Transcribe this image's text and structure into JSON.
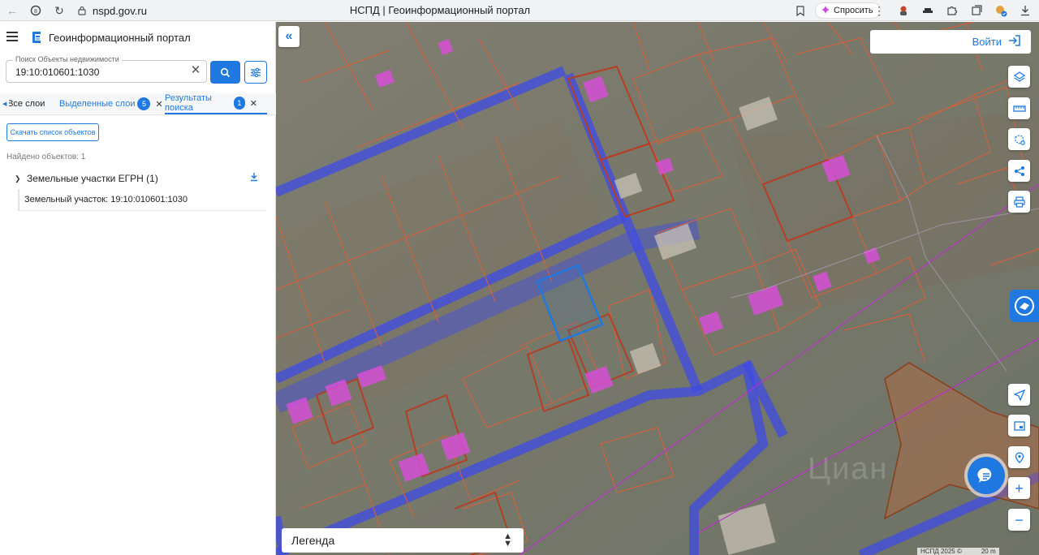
{
  "browser": {
    "url": "nspd.gov.ru",
    "tab_title": "НСПД | Геоинформационный портал",
    "ask_label": "Спросить"
  },
  "app": {
    "title": "Геоинформационный портал"
  },
  "search": {
    "legend": "Поиск Объекты недвижимости",
    "value": "19:10:010601:1030"
  },
  "tabs": [
    {
      "label": "Все слои"
    },
    {
      "label": "Выделенные слои",
      "badge": "5"
    },
    {
      "label": "Результаты поиска",
      "badge": "1"
    }
  ],
  "results": {
    "download_list": "Скачать список объектов",
    "found": "Найдено объектов: 1",
    "group_label": "Земельные участки ЕГРН (1)",
    "item_label": "Земельный участок: 19:10:010601:1030"
  },
  "map": {
    "login_label": "Войти",
    "legend_label": "Легенда",
    "watermark": "Циан",
    "attribution_left": "НСПД 2025 ©",
    "attribution_right": "20 m",
    "colors": {
      "parcel_border": "#d9603b",
      "building": "#d64fd6",
      "road_zone": "#3f4be6",
      "selected": "#1f79e0",
      "accent": "#1f79e0"
    }
  }
}
